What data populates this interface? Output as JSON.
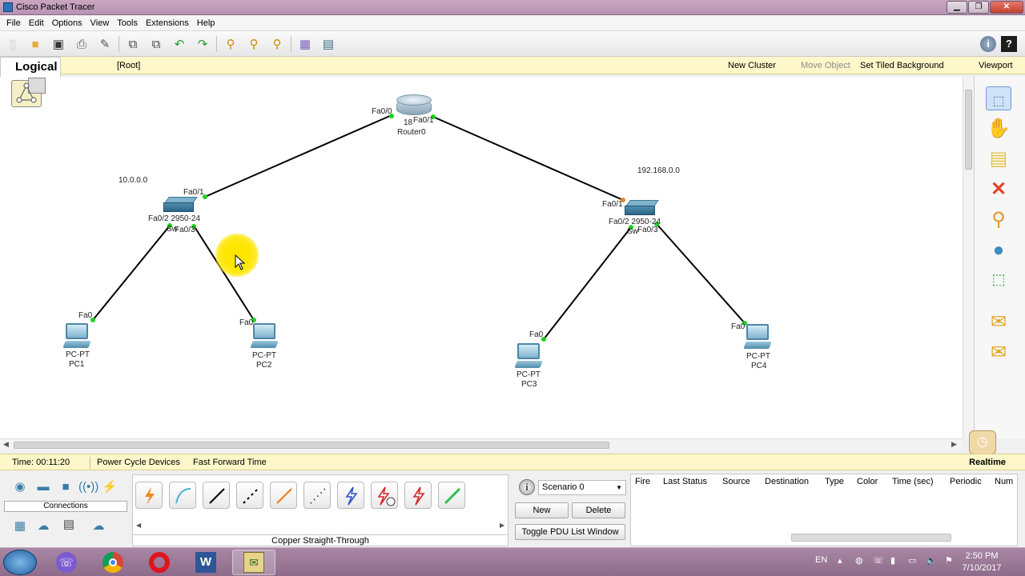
{
  "window": {
    "title": "Cisco Packet Tracer"
  },
  "menu": [
    "File",
    "Edit",
    "Options",
    "View",
    "Tools",
    "Extensions",
    "Help"
  ],
  "workspace": {
    "tab": "Logical",
    "root": "[Root]",
    "new_cluster": "New Cluster",
    "move_object": "Move Object",
    "set_tiled_background": "Set Tiled Background",
    "viewport": "Viewport"
  },
  "topology": {
    "notes": {
      "left_network": "10.0.0.0",
      "right_network": "192.168.0.0"
    },
    "router": {
      "type_partial": "18",
      "name": "Router0",
      "port_left": "Fa0/0",
      "port_right": "Fa0/1"
    },
    "switch_left": {
      "label_overlap": "Fa0/2 2950-24",
      "label_sw": "Sw",
      "port_up": "Fa0/1",
      "port_down": "Fa0/3"
    },
    "switch_right": {
      "label_overlap": "Fa0/2 2950-24",
      "label_sw": "Sw",
      "port_up": "Fa0/1",
      "port_down": "Fa0/3"
    },
    "pcs": [
      {
        "type": "PC-PT",
        "name": "PC1",
        "port": "Fa0"
      },
      {
        "type": "PC-PT",
        "name": "PC2",
        "port": "Fa0"
      },
      {
        "type": "PC-PT",
        "name": "PC3",
        "port": "Fa0"
      },
      {
        "type": "PC-PT",
        "name": "PC4",
        "port": "Fa0"
      }
    ]
  },
  "status": {
    "time": "Time: 00:11:20",
    "power_cycle": "Power Cycle Devices",
    "fast_forward": "Fast Forward Time",
    "mode": "Realtime"
  },
  "bottom": {
    "connections_label": "Connections",
    "selected_cable": "Copper Straight-Through",
    "scenario": "Scenario 0",
    "new_btn": "New",
    "delete_btn": "Delete",
    "toggle_btn": "Toggle PDU List Window",
    "pdu_columns": [
      "Fire",
      "Last Status",
      "Source",
      "Destination",
      "Type",
      "Color",
      "Time (sec)",
      "Periodic",
      "Num"
    ]
  },
  "taskbar": {
    "lang": "EN",
    "time": "2:50 PM",
    "date": "7/10/2017"
  },
  "colors": {
    "link_up": "#1ed21e",
    "link_pending": "#e8882b",
    "cursor_highlight": "#ffe600"
  }
}
